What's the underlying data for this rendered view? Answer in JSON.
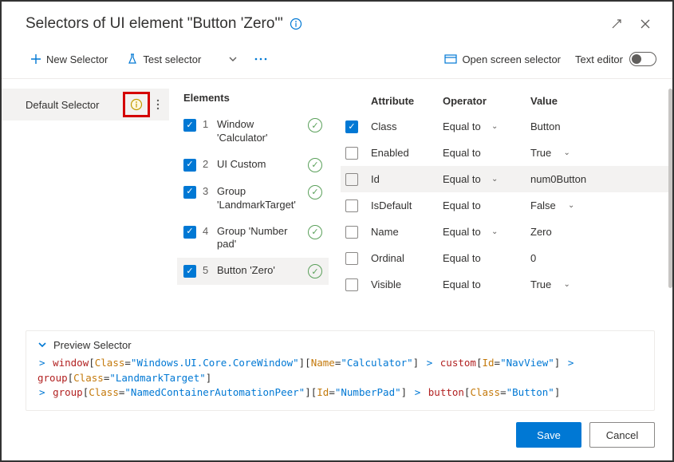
{
  "title": "Selectors of UI element \"Button 'Zero'\"",
  "toolbar": {
    "new_selector": "New Selector",
    "test_selector": "Test selector",
    "open_screen_selector": "Open screen selector",
    "text_editor": "Text editor"
  },
  "sidebar": {
    "default_selector_label": "Default Selector"
  },
  "elements": {
    "heading": "Elements",
    "rows": [
      {
        "n": "1",
        "name": "Window 'Calculator'",
        "checked": true,
        "valid": true,
        "selected": false
      },
      {
        "n": "2",
        "name": "UI Custom",
        "checked": true,
        "valid": true,
        "selected": false
      },
      {
        "n": "3",
        "name": "Group 'LandmarkTarget'",
        "checked": true,
        "valid": true,
        "selected": false
      },
      {
        "n": "4",
        "name": "Group 'Number pad'",
        "checked": true,
        "valid": true,
        "selected": false
      },
      {
        "n": "5",
        "name": "Button 'Zero'",
        "checked": true,
        "valid": true,
        "selected": true
      }
    ]
  },
  "attrs": {
    "head": {
      "attribute": "Attribute",
      "operator": "Operator",
      "value": "Value"
    },
    "rows": [
      {
        "checked": true,
        "name": "Class",
        "op": "Equal to",
        "op_chev": true,
        "value": "Button",
        "val_chev": false,
        "hover": false
      },
      {
        "checked": false,
        "name": "Enabled",
        "op": "Equal to",
        "op_chev": false,
        "value": "True",
        "val_chev": true,
        "hover": false
      },
      {
        "checked": false,
        "name": "Id",
        "op": "Equal to",
        "op_chev": true,
        "value": "num0Button",
        "val_chev": false,
        "hover": true
      },
      {
        "checked": false,
        "name": "IsDefault",
        "op": "Equal to",
        "op_chev": false,
        "value": "False",
        "val_chev": true,
        "hover": false
      },
      {
        "checked": false,
        "name": "Name",
        "op": "Equal to",
        "op_chev": true,
        "value": "Zero",
        "val_chev": false,
        "hover": false
      },
      {
        "checked": false,
        "name": "Ordinal",
        "op": "Equal to",
        "op_chev": false,
        "value": "0",
        "val_chev": false,
        "hover": false
      },
      {
        "checked": false,
        "name": "Visible",
        "op": "Equal to",
        "op_chev": false,
        "value": "True",
        "val_chev": true,
        "hover": false
      }
    ]
  },
  "preview": {
    "heading": "Preview Selector",
    "tokens": [
      {
        "t": "gt",
        "v": "> "
      },
      {
        "t": "elem",
        "v": "window"
      },
      {
        "t": "plain",
        "v": "["
      },
      {
        "t": "attr",
        "v": "Class"
      },
      {
        "t": "plain",
        "v": "="
      },
      {
        "t": "str",
        "v": "\"Windows.UI.Core.CoreWindow\""
      },
      {
        "t": "plain",
        "v": "]["
      },
      {
        "t": "attr",
        "v": "Name"
      },
      {
        "t": "plain",
        "v": "="
      },
      {
        "t": "str",
        "v": "\"Calculator\""
      },
      {
        "t": "plain",
        "v": "] "
      },
      {
        "t": "gt",
        "v": "> "
      },
      {
        "t": "elem",
        "v": "custom"
      },
      {
        "t": "plain",
        "v": "["
      },
      {
        "t": "attr",
        "v": "Id"
      },
      {
        "t": "plain",
        "v": "="
      },
      {
        "t": "str",
        "v": "\"NavView\""
      },
      {
        "t": "plain",
        "v": "] "
      },
      {
        "t": "gt",
        "v": "> "
      },
      {
        "t": "elem",
        "v": "group"
      },
      {
        "t": "plain",
        "v": "["
      },
      {
        "t": "attr",
        "v": "Class"
      },
      {
        "t": "plain",
        "v": "="
      },
      {
        "t": "str",
        "v": "\"LandmarkTarget\""
      },
      {
        "t": "plain",
        "v": "] "
      },
      {
        "t": "br"
      },
      {
        "t": "gt",
        "v": "> "
      },
      {
        "t": "elem",
        "v": "group"
      },
      {
        "t": "plain",
        "v": "["
      },
      {
        "t": "attr",
        "v": "Class"
      },
      {
        "t": "plain",
        "v": "="
      },
      {
        "t": "str",
        "v": "\"NamedContainerAutomationPeer\""
      },
      {
        "t": "plain",
        "v": "]["
      },
      {
        "t": "attr",
        "v": "Id"
      },
      {
        "t": "plain",
        "v": "="
      },
      {
        "t": "str",
        "v": "\"NumberPad\""
      },
      {
        "t": "plain",
        "v": "] "
      },
      {
        "t": "gt",
        "v": "> "
      },
      {
        "t": "elem",
        "v": "button"
      },
      {
        "t": "plain",
        "v": "["
      },
      {
        "t": "attr",
        "v": "Class"
      },
      {
        "t": "plain",
        "v": "="
      },
      {
        "t": "str",
        "v": "\"Button\""
      },
      {
        "t": "plain",
        "v": "]"
      }
    ]
  },
  "footer": {
    "save": "Save",
    "cancel": "Cancel"
  }
}
